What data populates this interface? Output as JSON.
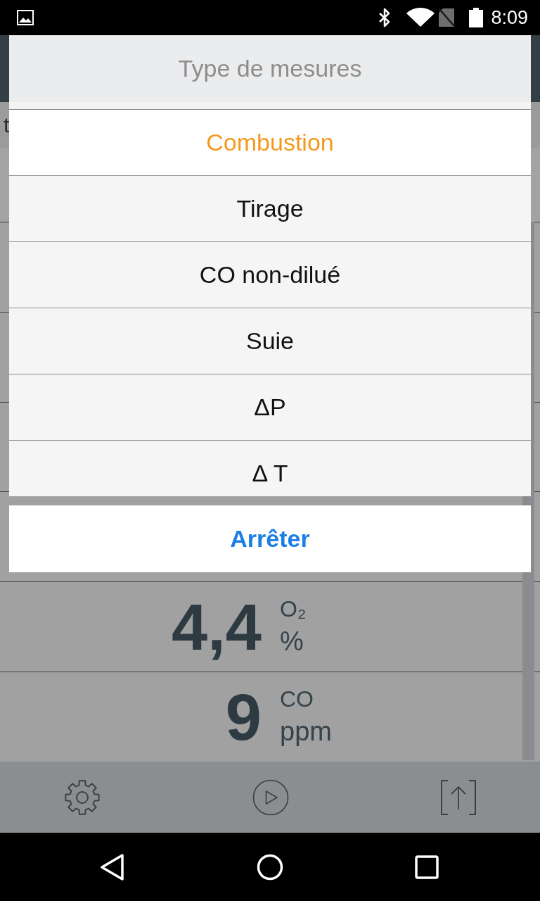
{
  "status_bar": {
    "time": "8:09"
  },
  "info_row": {
    "text": "t"
  },
  "readings": [
    {
      "value": "4,4",
      "gas": "O₂",
      "unit": "%"
    },
    {
      "value": "9",
      "gas": "CO",
      "unit": "ppm"
    }
  ],
  "toolbar": [
    {
      "kind": "settings"
    },
    {
      "kind": "play"
    },
    {
      "kind": "export"
    }
  ],
  "action_sheet": {
    "title": "Type de mesures",
    "options": [
      {
        "label": "Combustion",
        "selected": true
      },
      {
        "label": "Tirage",
        "selected": false
      },
      {
        "label": "CO non-dilué",
        "selected": false
      },
      {
        "label": "Suie",
        "selected": false
      },
      {
        "label": "ΔP",
        "selected": false
      },
      {
        "label": "Δ T",
        "selected": false
      }
    ],
    "cancel": "Arrêter"
  },
  "nav_bar": [
    {
      "kind": "back"
    },
    {
      "kind": "home"
    },
    {
      "kind": "recents"
    }
  ]
}
